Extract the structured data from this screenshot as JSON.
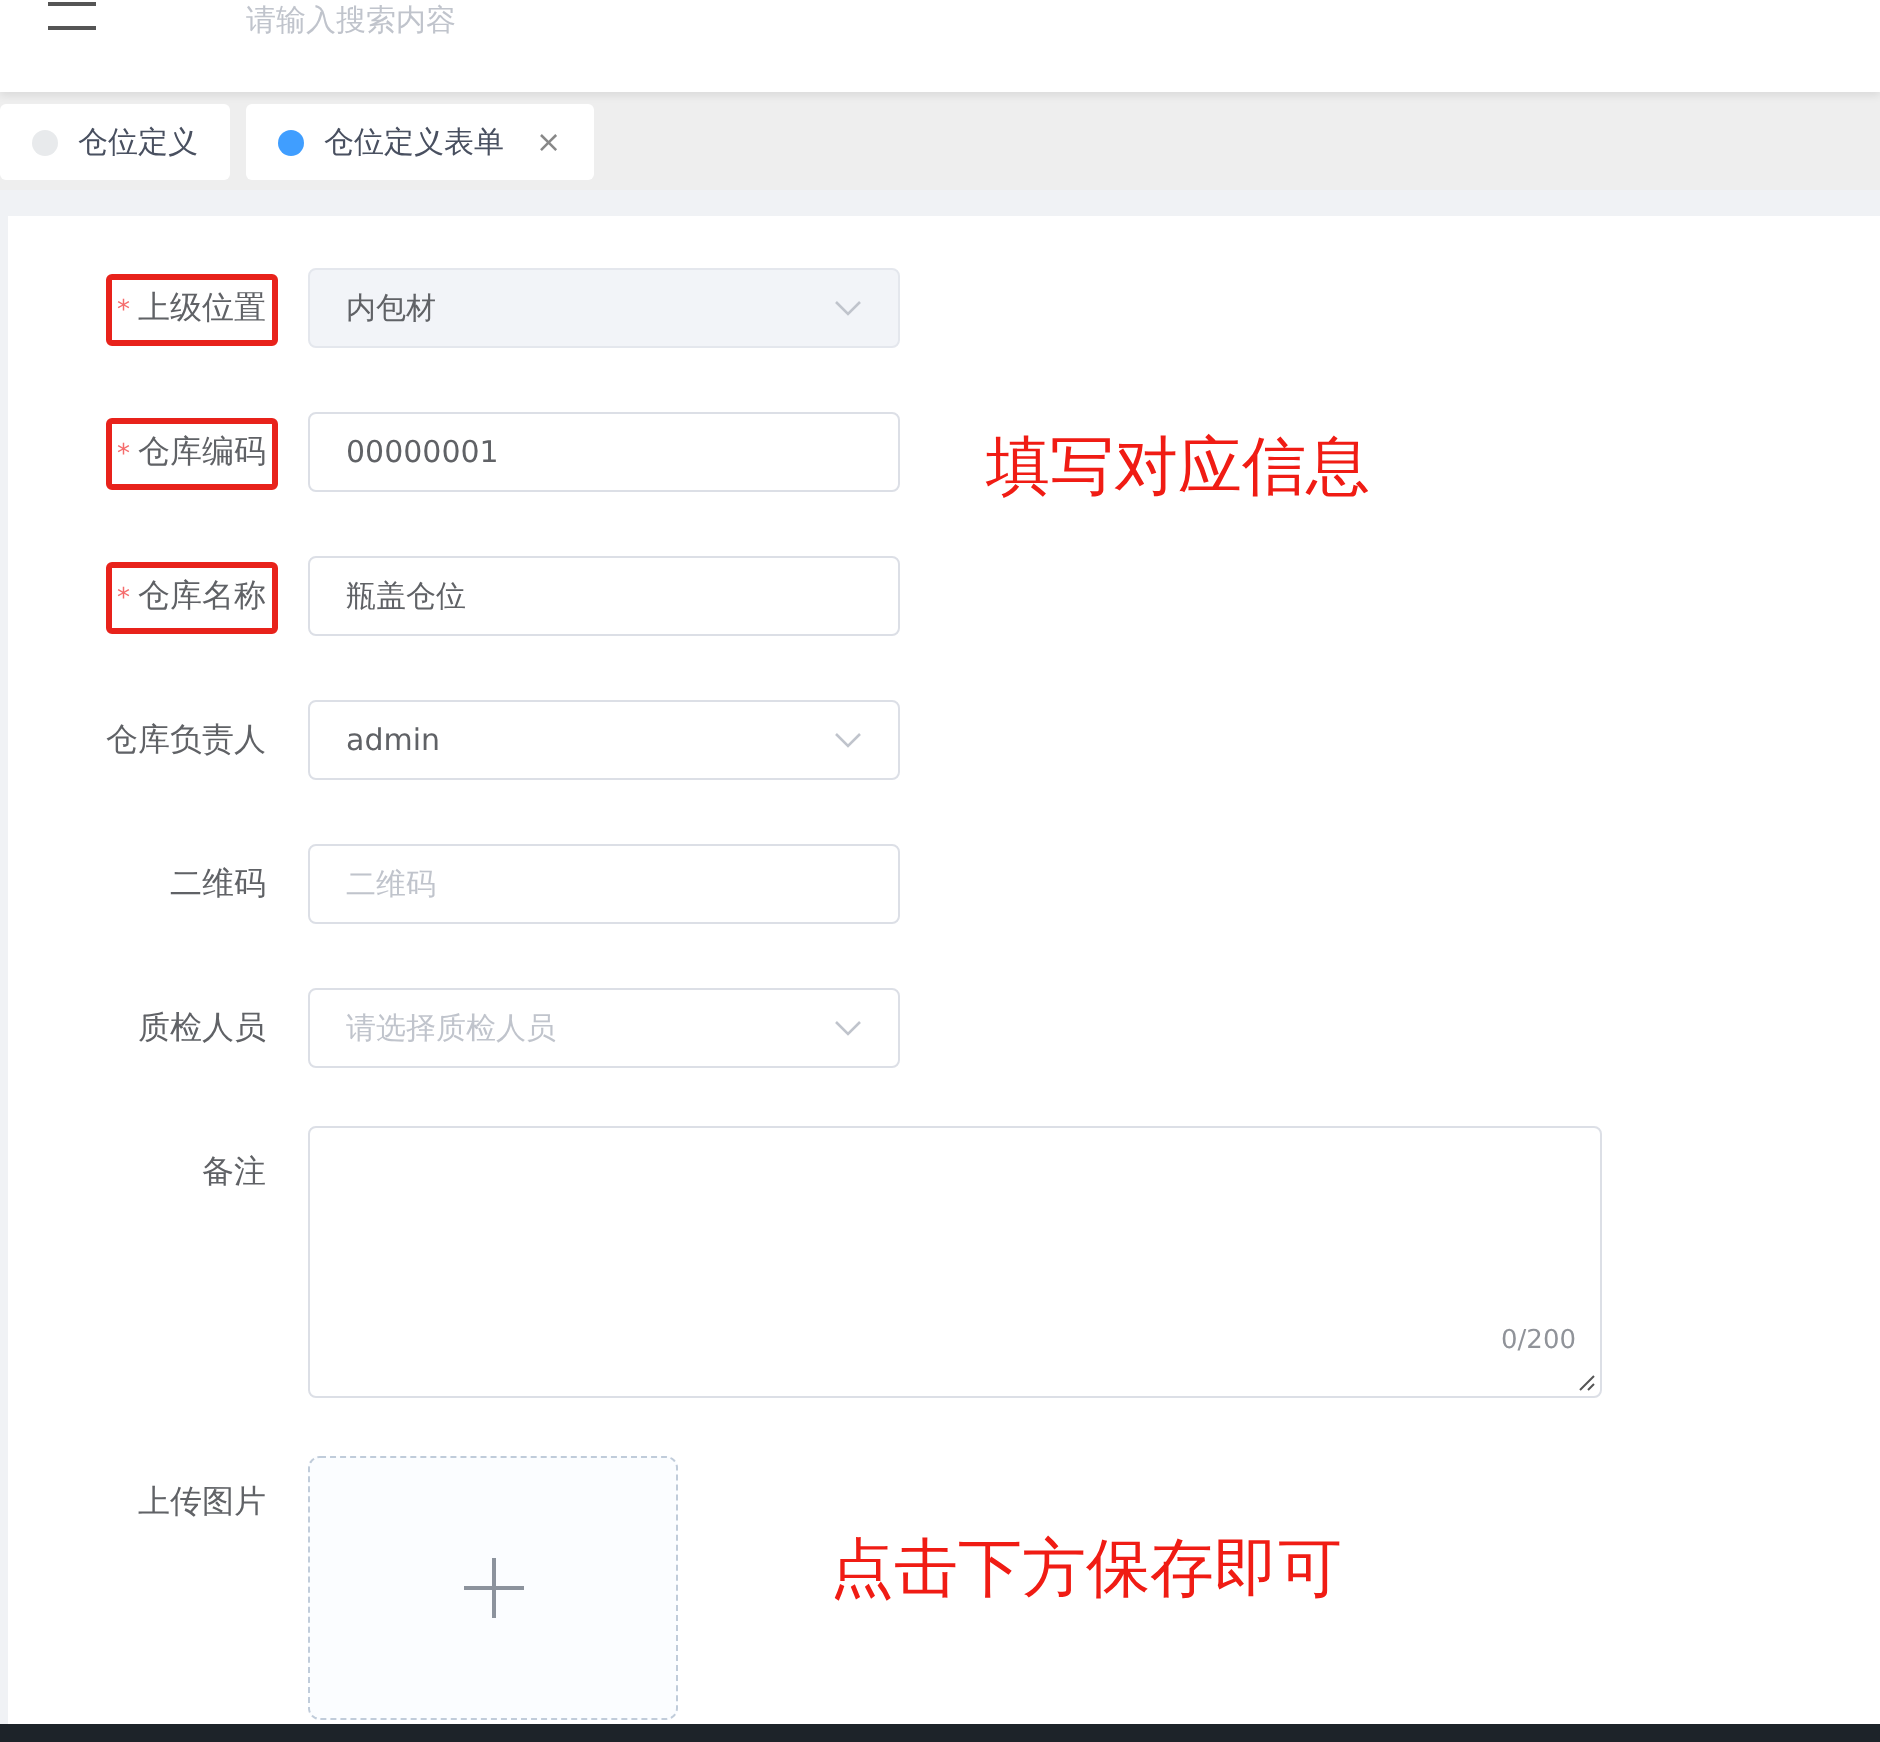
{
  "header": {
    "search": {
      "placeholder": "请输入搜索内容"
    }
  },
  "tabs": [
    {
      "label": "仓位定义",
      "selected": false
    },
    {
      "label": "仓位定义表单",
      "selected": true,
      "close": "×"
    }
  ],
  "form": {
    "fields": [
      {
        "kind": "select",
        "label": "上级位置",
        "required": "*",
        "highlighted": true,
        "value": "内包材",
        "disabled": true
      },
      {
        "kind": "input",
        "label": "仓库编码",
        "required": "*",
        "highlighted": true,
        "value": "00000001"
      },
      {
        "kind": "input",
        "label": "仓库名称",
        "required": "*",
        "highlighted": true,
        "value": "瓶盖仓位"
      },
      {
        "kind": "select",
        "label": "仓库负责人",
        "highlighted": false,
        "value": "admin"
      },
      {
        "kind": "input",
        "label": "二维码",
        "highlighted": false,
        "placeholder": "二维码"
      },
      {
        "kind": "select",
        "label": "质检人员",
        "highlighted": false,
        "placeholder": "请选择质检人员"
      },
      {
        "kind": "textarea",
        "label": "备注",
        "highlighted": false,
        "counter": "0/200"
      },
      {
        "kind": "upload",
        "label": "上传图片",
        "highlighted": false
      }
    ]
  },
  "annotations": [
    {
      "text": "填写对应信息"
    },
    {
      "text": "点击下方保存即可"
    }
  ]
}
